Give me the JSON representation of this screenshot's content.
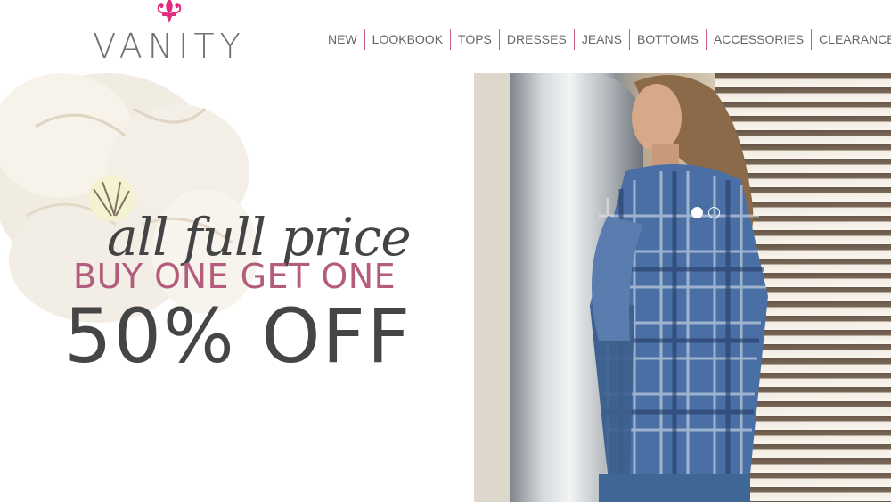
{
  "brand": {
    "name": "VANITY",
    "logo_color": "#e22b7c"
  },
  "nav": {
    "items": [
      {
        "label": "NEW"
      },
      {
        "label": "LOOKBOOK"
      },
      {
        "label": "TOPS"
      },
      {
        "label": "DRESSES"
      },
      {
        "label": "JEANS"
      },
      {
        "label": "BOTTOMS"
      },
      {
        "label": "ACCESSORIES"
      },
      {
        "label": "CLEARANCE"
      }
    ],
    "divider_color": "#c85a87"
  },
  "hero": {
    "script_text": "all full price",
    "bogo_text": "BUY ONE GET ONE",
    "discount_text": "50% OFF",
    "accent_color": "#b45c7d",
    "slides": {
      "count": 2,
      "active": 1
    }
  }
}
